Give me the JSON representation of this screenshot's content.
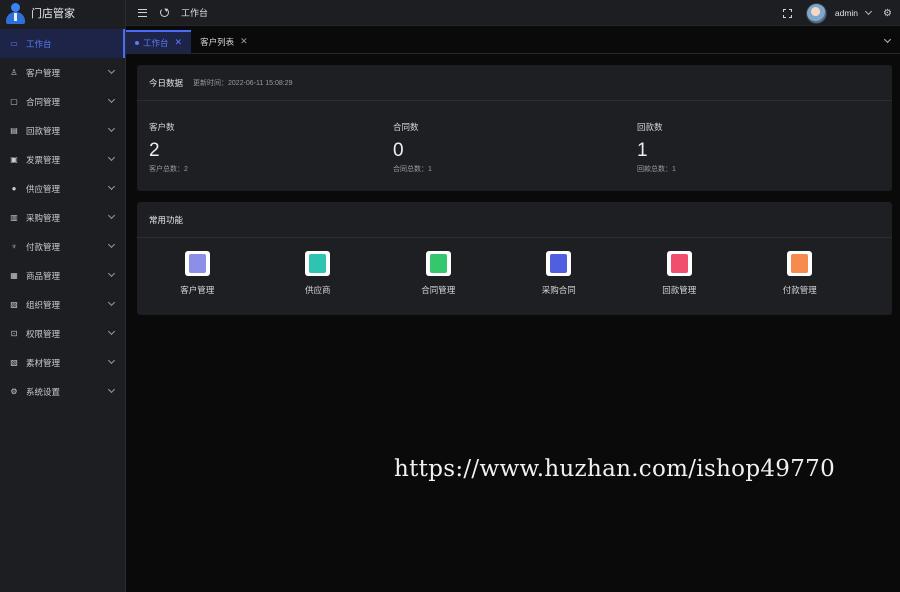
{
  "brand": {
    "title": "门店管家"
  },
  "sidebar": {
    "items": [
      {
        "label": "工作台",
        "icon": "monitor-icon",
        "active": true,
        "chevron": false
      },
      {
        "label": "客户管理",
        "icon": "user-icon",
        "active": false,
        "chevron": true
      },
      {
        "label": "合同管理",
        "icon": "contract-icon",
        "active": false,
        "chevron": true
      },
      {
        "label": "回款管理",
        "icon": "wallet-icon",
        "active": false,
        "chevron": true
      },
      {
        "label": "发票管理",
        "icon": "invoice-icon",
        "active": false,
        "chevron": true
      },
      {
        "label": "供应管理",
        "icon": "supply-icon",
        "active": false,
        "chevron": true
      },
      {
        "label": "采购管理",
        "icon": "purchase-icon",
        "active": false,
        "chevron": true
      },
      {
        "label": "付款管理",
        "icon": "trophy-icon",
        "active": false,
        "chevron": true
      },
      {
        "label": "商品管理",
        "icon": "goods-icon",
        "active": false,
        "chevron": true
      },
      {
        "label": "组织管理",
        "icon": "org-icon",
        "active": false,
        "chevron": true
      },
      {
        "label": "权限管理",
        "icon": "lock-icon",
        "active": false,
        "chevron": true
      },
      {
        "label": "素材管理",
        "icon": "image-icon",
        "active": false,
        "chevron": true
      },
      {
        "label": "系统设置",
        "icon": "gear-icon",
        "active": false,
        "chevron": true
      }
    ]
  },
  "header": {
    "title": "工作台",
    "username": "admin"
  },
  "tabs": [
    {
      "label": "工作台",
      "active": true
    },
    {
      "label": "客户列表",
      "active": false
    }
  ],
  "today": {
    "title": "今日数据",
    "updated": "更新时间：2022-06-11 15:08:29",
    "stats": [
      {
        "label": "客户数",
        "value": "2",
        "foot": "客户总数：2"
      },
      {
        "label": "合同数",
        "value": "0",
        "foot": "合同总数：1"
      },
      {
        "label": "回款数",
        "value": "1",
        "foot": "回款总数：1"
      }
    ]
  },
  "functions": {
    "title": "常用功能",
    "items": [
      {
        "label": "客户管理",
        "icon": "customer-icon",
        "color": "#8b8fe8"
      },
      {
        "label": "供应商",
        "icon": "supplier-icon",
        "color": "#2fc4b2"
      },
      {
        "label": "合同管理",
        "icon": "contract-icon",
        "color": "#35c76d"
      },
      {
        "label": "采购合同",
        "icon": "purchase-contract-icon",
        "color": "#4f5fe0"
      },
      {
        "label": "回款管理",
        "icon": "payment-back-icon",
        "color": "#f0506e"
      },
      {
        "label": "付款管理",
        "icon": "payment-icon",
        "color": "#f58b4c"
      }
    ]
  },
  "watermark": "https://www.huzhan.com/ishop49770",
  "colors": {
    "accent": "#4a6cf7",
    "background": "#0a0a0b",
    "panel": "#1d1f22"
  }
}
